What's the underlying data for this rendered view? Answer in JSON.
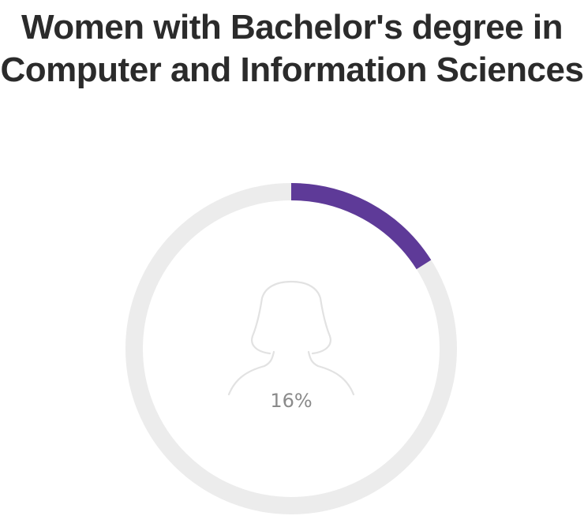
{
  "title": "Women with Bachelor's degree in Computer and Information Sciences",
  "chart_data": {
    "type": "pie",
    "title": "Women with Bachelor's degree in Computer and Information Sciences",
    "value_percent": 16,
    "display_label": "16%",
    "center_icon": "woman-silhouette-icon",
    "colors": {
      "filled": "#5e3a98",
      "track": "#ececec",
      "icon": "#e2e2e2",
      "label": "#8a8a8a"
    }
  }
}
